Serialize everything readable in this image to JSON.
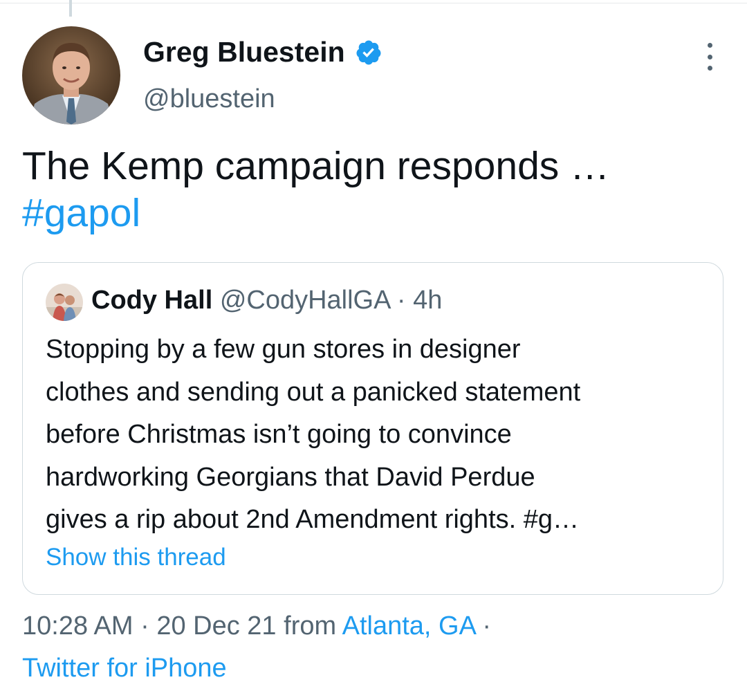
{
  "tweet": {
    "author": {
      "name": "Greg Bluestein",
      "handle": "@bluestein",
      "verified": true
    },
    "text_line1": "The Kemp campaign responds …",
    "hashtag": "#gapol",
    "time": "10:28 AM",
    "sep1": " · ",
    "date": "20 Dec 21",
    "from_label": " from ",
    "location": "Atlanta, GA",
    "sep2": " ·",
    "source": "Twitter for iPhone"
  },
  "quoted": {
    "name": "Cody Hall",
    "handle_time": "@CodyHallGA · 4h",
    "body_lines": [
      "Stopping by a few gun stores in designer",
      "clothes and sending out a panicked statement",
      "before Christmas isn’t going to convince",
      "hardworking Georgians that David Perdue",
      "gives a rip about 2nd Amendment rights. #g…"
    ],
    "show_thread": "Show this thread"
  },
  "colors": {
    "link": "#1d9bf0",
    "secondary_text": "#536471",
    "primary_text": "#0f1419",
    "border": "#cfd9de"
  },
  "icons": [
    "verified-badge-icon",
    "more-options-icon"
  ]
}
